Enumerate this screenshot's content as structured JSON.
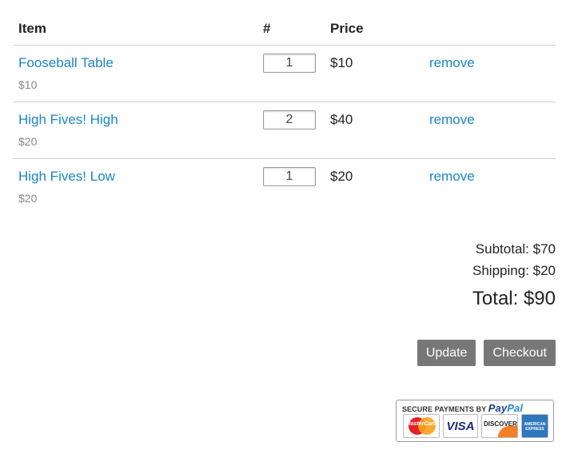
{
  "cart": {
    "headers": {
      "item": "Item",
      "qty": "#",
      "price": "Price"
    },
    "items": [
      {
        "name": "Fooseball Table",
        "unit_price": "$10",
        "quantity": "1",
        "line_price": "$10",
        "remove_label": "remove"
      },
      {
        "name": "High Fives! High",
        "unit_price": "$20",
        "quantity": "2",
        "line_price": "$40",
        "remove_label": "remove"
      },
      {
        "name": "High Fives! Low",
        "unit_price": "$20",
        "quantity": "1",
        "line_price": "$20",
        "remove_label": "remove"
      }
    ]
  },
  "totals": {
    "subtotal": "Subtotal: $70",
    "shipping": "Shipping: $20",
    "total": "Total: $90"
  },
  "actions": {
    "update_label": "Update",
    "checkout_label": "Checkout"
  },
  "paypal_badge": {
    "heading": "SECURE PAYMENTS BY",
    "brand_pay": "Pay",
    "brand_pal": "Pal",
    "cards": [
      "MasterCard",
      "VISA",
      "DISCOVER",
      "AMERICAN EXPRESS"
    ]
  },
  "colors": {
    "link": "#1a86c8",
    "button": "#777777",
    "divider": "#cfcfcf"
  }
}
